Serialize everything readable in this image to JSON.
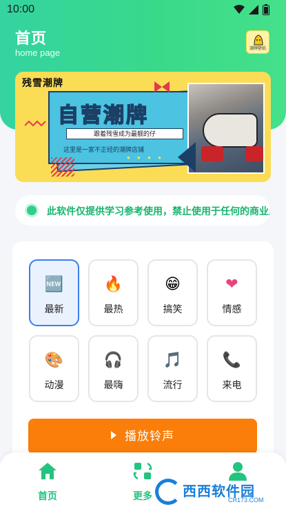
{
  "status_bar": {
    "time": "10:00"
  },
  "header": {
    "title": "首页",
    "subtitle": "home page",
    "logo_text": "潮牌壁纸"
  },
  "banner": {
    "brand": "残雪潮牌",
    "headline": "自营潮牌",
    "line1": "跟着残雪成为最靓的仔",
    "line2": "这里是一家不正经的潮牌店铺",
    "dots": "● ● ● ●"
  },
  "notice": {
    "text": "此软件仅提供学习参考使用，禁止使用于任何的商业用途"
  },
  "categories": [
    {
      "label": "最新",
      "icon": "new-icon",
      "glyph": "🆕"
    },
    {
      "label": "最热",
      "icon": "fire-icon",
      "glyph": "🔥"
    },
    {
      "label": "搞笑",
      "icon": "grin-icon",
      "glyph": "😁"
    },
    {
      "label": "情感",
      "icon": "heart-icon",
      "glyph": "❤"
    },
    {
      "label": "动漫",
      "icon": "palette-icon",
      "glyph": "🎨"
    },
    {
      "label": "最嗨",
      "icon": "headphones-icon",
      "glyph": "🎧"
    },
    {
      "label": "流行",
      "icon": "music-note-icon",
      "glyph": "🎵"
    },
    {
      "label": "来电",
      "icon": "phone-icon",
      "glyph": "📞"
    }
  ],
  "play_button": {
    "label": "播放铃声"
  },
  "bottom_nav": {
    "items": [
      {
        "label": "首页",
        "icon": "home-icon"
      },
      {
        "label": "更多",
        "icon": "more-icon"
      },
      {
        "label": "",
        "icon": "user-icon"
      }
    ]
  },
  "watermark": {
    "text": "西西软件园",
    "sub": "CR173.COM"
  },
  "colors": {
    "accent": "#34d3a0",
    "button": "#fb7d0a",
    "active_tile": "#3a7de8",
    "nav_active": "#22c47f"
  }
}
